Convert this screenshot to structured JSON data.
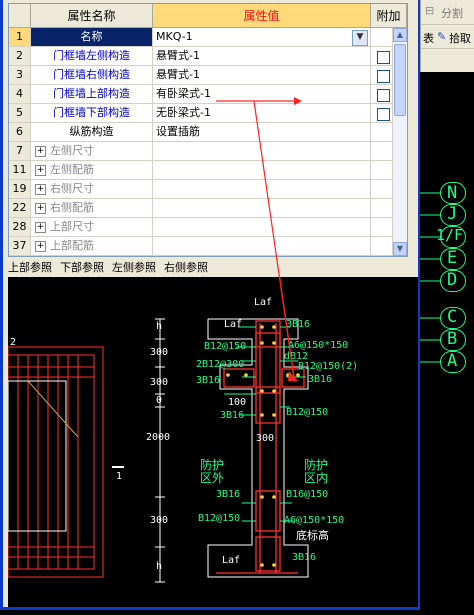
{
  "toolbar_right": {
    "item1": "分割",
    "item2": "表",
    "item3": "拾取"
  },
  "axis_labels": [
    "N",
    "J",
    "1/F",
    "E",
    "D",
    "C",
    "B",
    "A"
  ],
  "grid": {
    "headers": {
      "num": "",
      "name": "属性名称",
      "value": "属性值",
      "extra": "附加"
    },
    "rows": [
      {
        "num": "1",
        "name": "名称",
        "value": "MKQ-1",
        "style": "sel",
        "expander": false,
        "checkbox": false,
        "combo": true
      },
      {
        "num": "2",
        "name": "门框墙左侧构造",
        "value": "悬臂式-1",
        "style": "blue",
        "expander": false,
        "checkbox": true
      },
      {
        "num": "3",
        "name": "门框墙右侧构造",
        "value": "悬臂式-1",
        "style": "blue",
        "expander": false,
        "checkbox": true
      },
      {
        "num": "4",
        "name": "门框墙上部构造",
        "value": "有卧梁式-1",
        "style": "blue",
        "expander": false,
        "checkbox": true
      },
      {
        "num": "5",
        "name": "门框墙下部构造",
        "value": "无卧梁式-1",
        "style": "blue",
        "expander": false,
        "checkbox": true
      },
      {
        "num": "6",
        "name": "纵筋构造",
        "value": "设置插筋",
        "style": "black",
        "expander": false,
        "checkbox": false
      },
      {
        "num": "7",
        "name": "左侧尺寸",
        "value": "",
        "style": "gray",
        "expander": true,
        "checkbox": false
      },
      {
        "num": "11",
        "name": "左侧配筋",
        "value": "",
        "style": "gray",
        "expander": true,
        "checkbox": false
      },
      {
        "num": "19",
        "name": "右侧尺寸",
        "value": "",
        "style": "gray",
        "expander": true,
        "checkbox": false
      },
      {
        "num": "22",
        "name": "右侧配筋",
        "value": "",
        "style": "gray",
        "expander": true,
        "checkbox": false
      },
      {
        "num": "28",
        "name": "上部尺寸",
        "value": "",
        "style": "gray",
        "expander": true,
        "checkbox": false
      },
      {
        "num": "37",
        "name": "上部配筋",
        "value": "",
        "style": "gray",
        "expander": true,
        "checkbox": false
      }
    ]
  },
  "tabs": [
    "上部参照",
    "下部参照",
    "左侧参照",
    "右侧参照"
  ],
  "drawing": {
    "dims": {
      "h_top": "h",
      "d300a": "300",
      "d300b": "300",
      "d0": "0",
      "d2000": "2000",
      "d300c": "300",
      "h_bot": "h",
      "w300": "300",
      "w100": "100"
    },
    "labels": {
      "laf_top": "Laf",
      "laf_left": "Laf",
      "b16_top": "3B16",
      "b12_150_a": "B12@150",
      "a6_150_a": "A6@150*150",
      "b12_300": "2B12@300",
      "d_b12": "dB12",
      "b12_150_2": "B12@150(2)",
      "b16_l": "3B16",
      "b16_r": "3B16",
      "b16_mid": "3B16",
      "b12_150_b": "B12@150",
      "outside": "防护\n区外",
      "inside": "防护\n区内",
      "b16_low_l": "3B16",
      "b16_150": "B16@150",
      "b12_150_c": "B12@150",
      "a6_150_b": "A6@150*150",
      "bottom_elev": "底标高",
      "laf_bot": "Laf",
      "b16_bot": "3B16",
      "left_mark": "2",
      "one_mark": "1"
    }
  },
  "colors": {
    "selection": "#0a246a",
    "header_accent": "#ffd97a",
    "cad_green": "#18ff8a",
    "cad_red": "#ff3030"
  }
}
